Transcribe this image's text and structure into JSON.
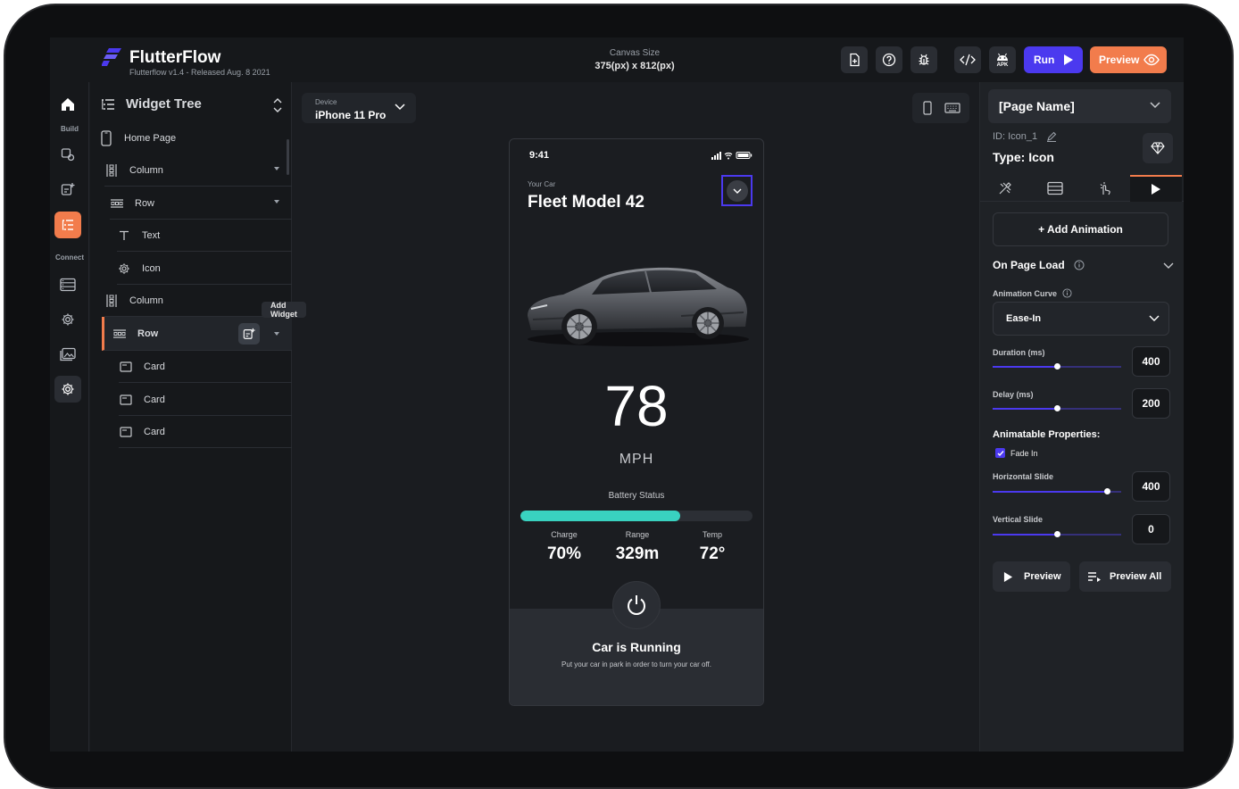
{
  "app": {
    "brand": "FlutterFlow",
    "version": "Flutterflow v1.4 - Released Aug. 8 2021",
    "accent": "#4b39ef",
    "secondary": "#f27c4c"
  },
  "topbar": {
    "canvas_label": "Canvas Size",
    "canvas_value": "375(px) x 812(px)",
    "icons": [
      "add-page-icon",
      "help-icon",
      "debug-icon",
      "code-icon",
      "android-apk-icon"
    ],
    "apk_label": "APK",
    "run_label": "Run",
    "preview_label": "Preview"
  },
  "rail": {
    "build_label": "Build",
    "connect_label": "Connect"
  },
  "widget_tree": {
    "title": "Widget Tree",
    "add_widget_tooltip": "Add Widget",
    "nodes": [
      {
        "label": "Home Page",
        "icon": "phone-icon"
      },
      {
        "label": "Column",
        "icon": "column-icon"
      },
      {
        "label": "Row",
        "icon": "row-icon"
      },
      {
        "label": "Text",
        "icon": "text-icon"
      },
      {
        "label": "Icon",
        "icon": "gear-icon"
      },
      {
        "label": "Column",
        "icon": "column-icon"
      },
      {
        "label": "Row",
        "icon": "row-icon"
      },
      {
        "label": "Card",
        "icon": "card-icon"
      },
      {
        "label": "Card",
        "icon": "card-icon"
      },
      {
        "label": "Card",
        "icon": "card-icon"
      }
    ]
  },
  "device": {
    "label": "Device",
    "value": "iPhone 11 Pro"
  },
  "phone": {
    "time": "9:41",
    "your_car": "Your Car",
    "model": "Fleet Model 42",
    "speed": "78",
    "unit": "MPH",
    "battery_label": "Battery Status",
    "battery_level": 0.69,
    "battery_color": "#39d2c0",
    "stats": [
      {
        "label": "Charge",
        "value": "70%"
      },
      {
        "label": "Range",
        "value": "329m"
      },
      {
        "label": "Temp",
        "value": "72°"
      }
    ],
    "running_title": "Car is Running",
    "running_sub": "Put your car in park in order to turn your car off."
  },
  "properties": {
    "page_name": "[Page Name]",
    "id": "ID: Icon_1",
    "type": "Type: Icon",
    "add_animation": "+ Add Animation",
    "on_page_load": "On Page Load",
    "animation_curve_label": "Animation Curve",
    "animation_curve": "Ease-In",
    "duration_label": "Duration (ms)",
    "duration": "400",
    "duration_level": 0.5,
    "delay_label": "Delay (ms)",
    "delay": "200",
    "delay_level": 0.5,
    "animatable_label": "Animatable Properties:",
    "fade_in": "Fade In",
    "horizontal_label": "Horizontal Slide",
    "horizontal": "400",
    "horizontal_level": 0.89,
    "vertical_label": "Vertical Slide",
    "vertical": "0",
    "vertical_level": 0.5,
    "preview_label": "Preview",
    "preview_all_label": "Preview All"
  }
}
